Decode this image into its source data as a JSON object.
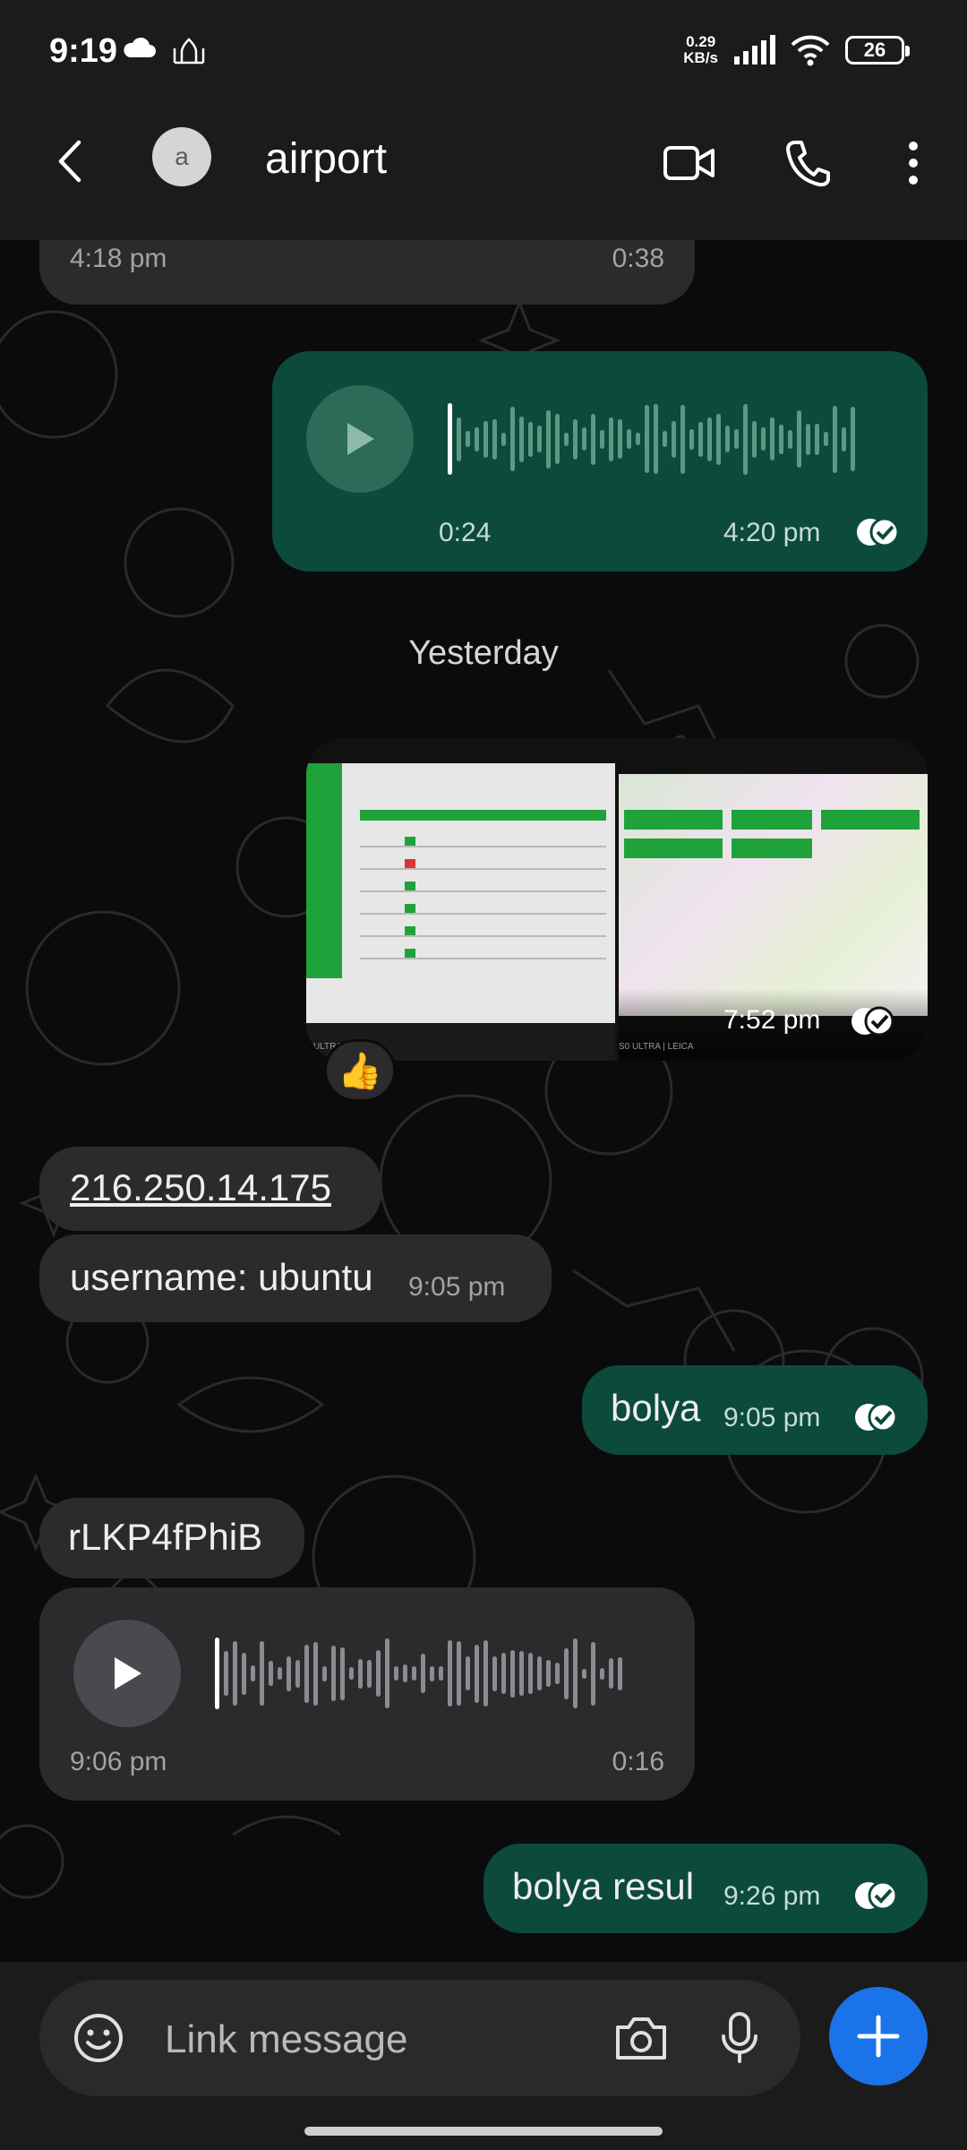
{
  "status_bar": {
    "time": "9:19",
    "net_speed_value": "0.29",
    "net_speed_unit": "KB/s",
    "battery": "26",
    "icons": [
      "cloud-icon",
      "mosque-icon",
      "signal-icon",
      "wifi-icon",
      "battery-icon"
    ]
  },
  "header": {
    "avatar_letter": "a",
    "contact_name": "airport",
    "icons": [
      "back-arrow-icon",
      "video-call-icon",
      "phone-call-icon",
      "more-vertical-icon"
    ]
  },
  "messages": {
    "m1": {
      "time": "4:18 pm",
      "duration": "0:38"
    },
    "m2": {
      "duration": "0:24",
      "time": "4:20 pm"
    },
    "date_separator": "Yesterday",
    "m3": {
      "time": "7:52 pm",
      "reaction": "👍",
      "caption_left": "ULTRA | LEICA",
      "caption_right": "S0 ULTRA | LEICA"
    },
    "m4": {
      "text": "216.250.14.175"
    },
    "m5": {
      "text": "username: ubuntu",
      "time": "9:05 pm"
    },
    "m6": {
      "text": "bolya",
      "time": "9:05 pm"
    },
    "m7": {
      "text": "rLKP4fPhiB"
    },
    "m8": {
      "time": "9:06 pm",
      "duration": "0:16"
    },
    "m9": {
      "text": "bolya resul",
      "time": "9:26 pm"
    }
  },
  "input": {
    "placeholder": "Link message",
    "icons": [
      "emoji-icon",
      "camera-icon",
      "microphone-icon",
      "plus-icon"
    ]
  },
  "colors": {
    "outgoing_bubble": "#0c4a3b",
    "incoming_bubble": "#2b2b2e",
    "fab": "#1a73e8",
    "read_tick": "#ffffff"
  }
}
